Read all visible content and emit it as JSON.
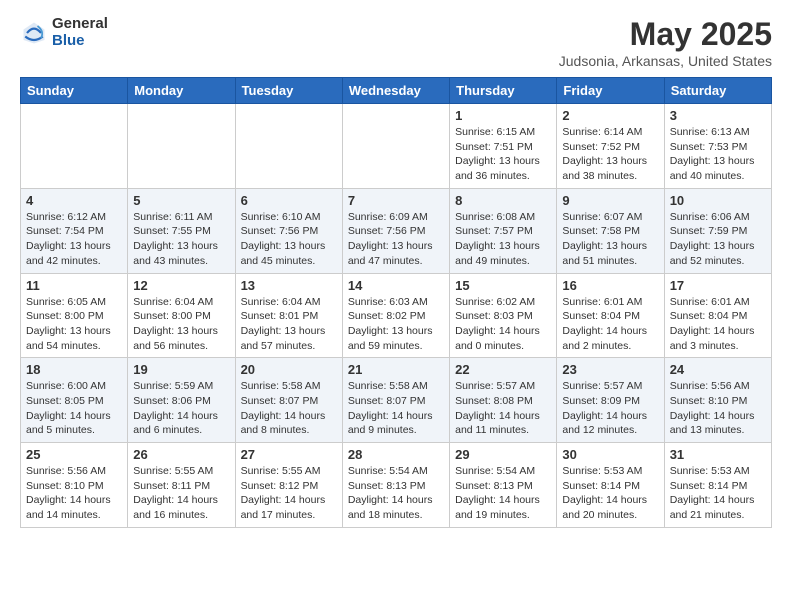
{
  "header": {
    "logo_general": "General",
    "logo_blue": "Blue",
    "month_title": "May 2025",
    "location": "Judsonia, Arkansas, United States"
  },
  "calendar": {
    "days_of_week": [
      "Sunday",
      "Monday",
      "Tuesday",
      "Wednesday",
      "Thursday",
      "Friday",
      "Saturday"
    ],
    "weeks": [
      [
        {
          "day": "",
          "info": ""
        },
        {
          "day": "",
          "info": ""
        },
        {
          "day": "",
          "info": ""
        },
        {
          "day": "",
          "info": ""
        },
        {
          "day": "1",
          "info": "Sunrise: 6:15 AM\nSunset: 7:51 PM\nDaylight: 13 hours\nand 36 minutes."
        },
        {
          "day": "2",
          "info": "Sunrise: 6:14 AM\nSunset: 7:52 PM\nDaylight: 13 hours\nand 38 minutes."
        },
        {
          "day": "3",
          "info": "Sunrise: 6:13 AM\nSunset: 7:53 PM\nDaylight: 13 hours\nand 40 minutes."
        }
      ],
      [
        {
          "day": "4",
          "info": "Sunrise: 6:12 AM\nSunset: 7:54 PM\nDaylight: 13 hours\nand 42 minutes."
        },
        {
          "day": "5",
          "info": "Sunrise: 6:11 AM\nSunset: 7:55 PM\nDaylight: 13 hours\nand 43 minutes."
        },
        {
          "day": "6",
          "info": "Sunrise: 6:10 AM\nSunset: 7:56 PM\nDaylight: 13 hours\nand 45 minutes."
        },
        {
          "day": "7",
          "info": "Sunrise: 6:09 AM\nSunset: 7:56 PM\nDaylight: 13 hours\nand 47 minutes."
        },
        {
          "day": "8",
          "info": "Sunrise: 6:08 AM\nSunset: 7:57 PM\nDaylight: 13 hours\nand 49 minutes."
        },
        {
          "day": "9",
          "info": "Sunrise: 6:07 AM\nSunset: 7:58 PM\nDaylight: 13 hours\nand 51 minutes."
        },
        {
          "day": "10",
          "info": "Sunrise: 6:06 AM\nSunset: 7:59 PM\nDaylight: 13 hours\nand 52 minutes."
        }
      ],
      [
        {
          "day": "11",
          "info": "Sunrise: 6:05 AM\nSunset: 8:00 PM\nDaylight: 13 hours\nand 54 minutes."
        },
        {
          "day": "12",
          "info": "Sunrise: 6:04 AM\nSunset: 8:00 PM\nDaylight: 13 hours\nand 56 minutes."
        },
        {
          "day": "13",
          "info": "Sunrise: 6:04 AM\nSunset: 8:01 PM\nDaylight: 13 hours\nand 57 minutes."
        },
        {
          "day": "14",
          "info": "Sunrise: 6:03 AM\nSunset: 8:02 PM\nDaylight: 13 hours\nand 59 minutes."
        },
        {
          "day": "15",
          "info": "Sunrise: 6:02 AM\nSunset: 8:03 PM\nDaylight: 14 hours\nand 0 minutes."
        },
        {
          "day": "16",
          "info": "Sunrise: 6:01 AM\nSunset: 8:04 PM\nDaylight: 14 hours\nand 2 minutes."
        },
        {
          "day": "17",
          "info": "Sunrise: 6:01 AM\nSunset: 8:04 PM\nDaylight: 14 hours\nand 3 minutes."
        }
      ],
      [
        {
          "day": "18",
          "info": "Sunrise: 6:00 AM\nSunset: 8:05 PM\nDaylight: 14 hours\nand 5 minutes."
        },
        {
          "day": "19",
          "info": "Sunrise: 5:59 AM\nSunset: 8:06 PM\nDaylight: 14 hours\nand 6 minutes."
        },
        {
          "day": "20",
          "info": "Sunrise: 5:58 AM\nSunset: 8:07 PM\nDaylight: 14 hours\nand 8 minutes."
        },
        {
          "day": "21",
          "info": "Sunrise: 5:58 AM\nSunset: 8:07 PM\nDaylight: 14 hours\nand 9 minutes."
        },
        {
          "day": "22",
          "info": "Sunrise: 5:57 AM\nSunset: 8:08 PM\nDaylight: 14 hours\nand 11 minutes."
        },
        {
          "day": "23",
          "info": "Sunrise: 5:57 AM\nSunset: 8:09 PM\nDaylight: 14 hours\nand 12 minutes."
        },
        {
          "day": "24",
          "info": "Sunrise: 5:56 AM\nSunset: 8:10 PM\nDaylight: 14 hours\nand 13 minutes."
        }
      ],
      [
        {
          "day": "25",
          "info": "Sunrise: 5:56 AM\nSunset: 8:10 PM\nDaylight: 14 hours\nand 14 minutes."
        },
        {
          "day": "26",
          "info": "Sunrise: 5:55 AM\nSunset: 8:11 PM\nDaylight: 14 hours\nand 16 minutes."
        },
        {
          "day": "27",
          "info": "Sunrise: 5:55 AM\nSunset: 8:12 PM\nDaylight: 14 hours\nand 17 minutes."
        },
        {
          "day": "28",
          "info": "Sunrise: 5:54 AM\nSunset: 8:13 PM\nDaylight: 14 hours\nand 18 minutes."
        },
        {
          "day": "29",
          "info": "Sunrise: 5:54 AM\nSunset: 8:13 PM\nDaylight: 14 hours\nand 19 minutes."
        },
        {
          "day": "30",
          "info": "Sunrise: 5:53 AM\nSunset: 8:14 PM\nDaylight: 14 hours\nand 20 minutes."
        },
        {
          "day": "31",
          "info": "Sunrise: 5:53 AM\nSunset: 8:14 PM\nDaylight: 14 hours\nand 21 minutes."
        }
      ]
    ]
  }
}
